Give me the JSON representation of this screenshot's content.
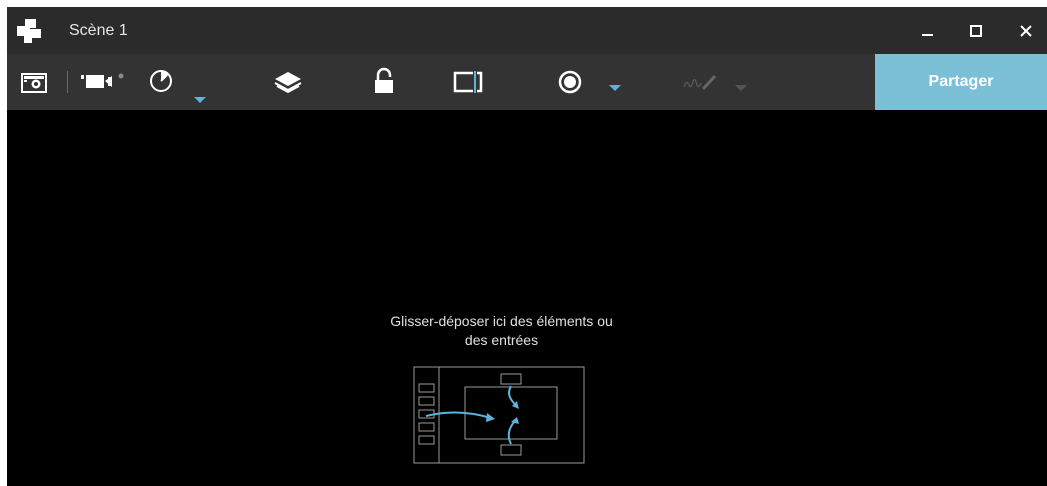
{
  "window": {
    "title": "Scène 1",
    "app_icon": "app-logo-icon",
    "controls": [
      "minimize-icon",
      "maximize-icon",
      "close-icon"
    ]
  },
  "toolbar": {
    "items": [
      {
        "name": "snapshot-button",
        "icon": "camera-icon"
      },
      {
        "name": "record-button",
        "icon": "video-camera-icon"
      },
      {
        "name": "timer-button",
        "icon": "timer-icon"
      },
      {
        "name": "layers-button",
        "icon": "layers-icon"
      },
      {
        "name": "lock-button",
        "icon": "unlock-icon"
      },
      {
        "name": "crop-button",
        "icon": "crop-frame-icon"
      },
      {
        "name": "record-mode-button",
        "icon": "record-dot-icon"
      },
      {
        "name": "annotate-button",
        "icon": "pen-signature-icon",
        "disabled": true
      }
    ],
    "share_label": "Partager"
  },
  "canvas": {
    "drop_line1": "Glisser-déposer ici des éléments ou",
    "drop_line2": "des entrées",
    "illustration": "drag-drop-illustration-icon"
  },
  "colors": {
    "titlebar": "#2b2b2b",
    "toolbar": "#333333",
    "accent": "#7cc0d8",
    "arrow": "#5ab4dc",
    "canvas": "#000000"
  }
}
